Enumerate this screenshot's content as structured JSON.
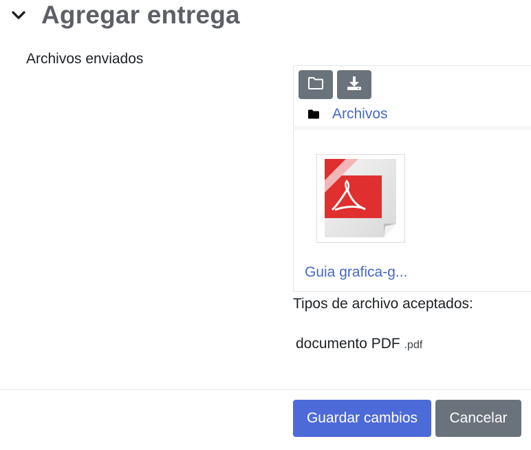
{
  "section": {
    "title": "Agregar entrega",
    "collapse_icon": "chevron-down-icon"
  },
  "form": {
    "files_label": "Archivos enviados"
  },
  "filemanager": {
    "toolbar": {
      "add_icon": "folder-icon",
      "download_icon": "download-icon"
    },
    "path": {
      "icon": "folder-solid-icon",
      "label": "Archivos"
    },
    "files": [
      {
        "name": "Guia grafica-g...",
        "thumbnail_icon": "pdf-file-icon"
      }
    ]
  },
  "accepted_types": {
    "title": "Tipos de archivo aceptados:",
    "items": [
      {
        "label": "documento PDF",
        "ext": ".pdf"
      }
    ]
  },
  "actions": {
    "save_label": "Guardar cambios",
    "cancel_label": "Cancelar"
  },
  "colors": {
    "link": "#4768c7",
    "primary_button": "#4d6ad9",
    "secondary_button": "#6a737b",
    "heading": "#5d6066",
    "pdf_red": "#e02f2f"
  }
}
